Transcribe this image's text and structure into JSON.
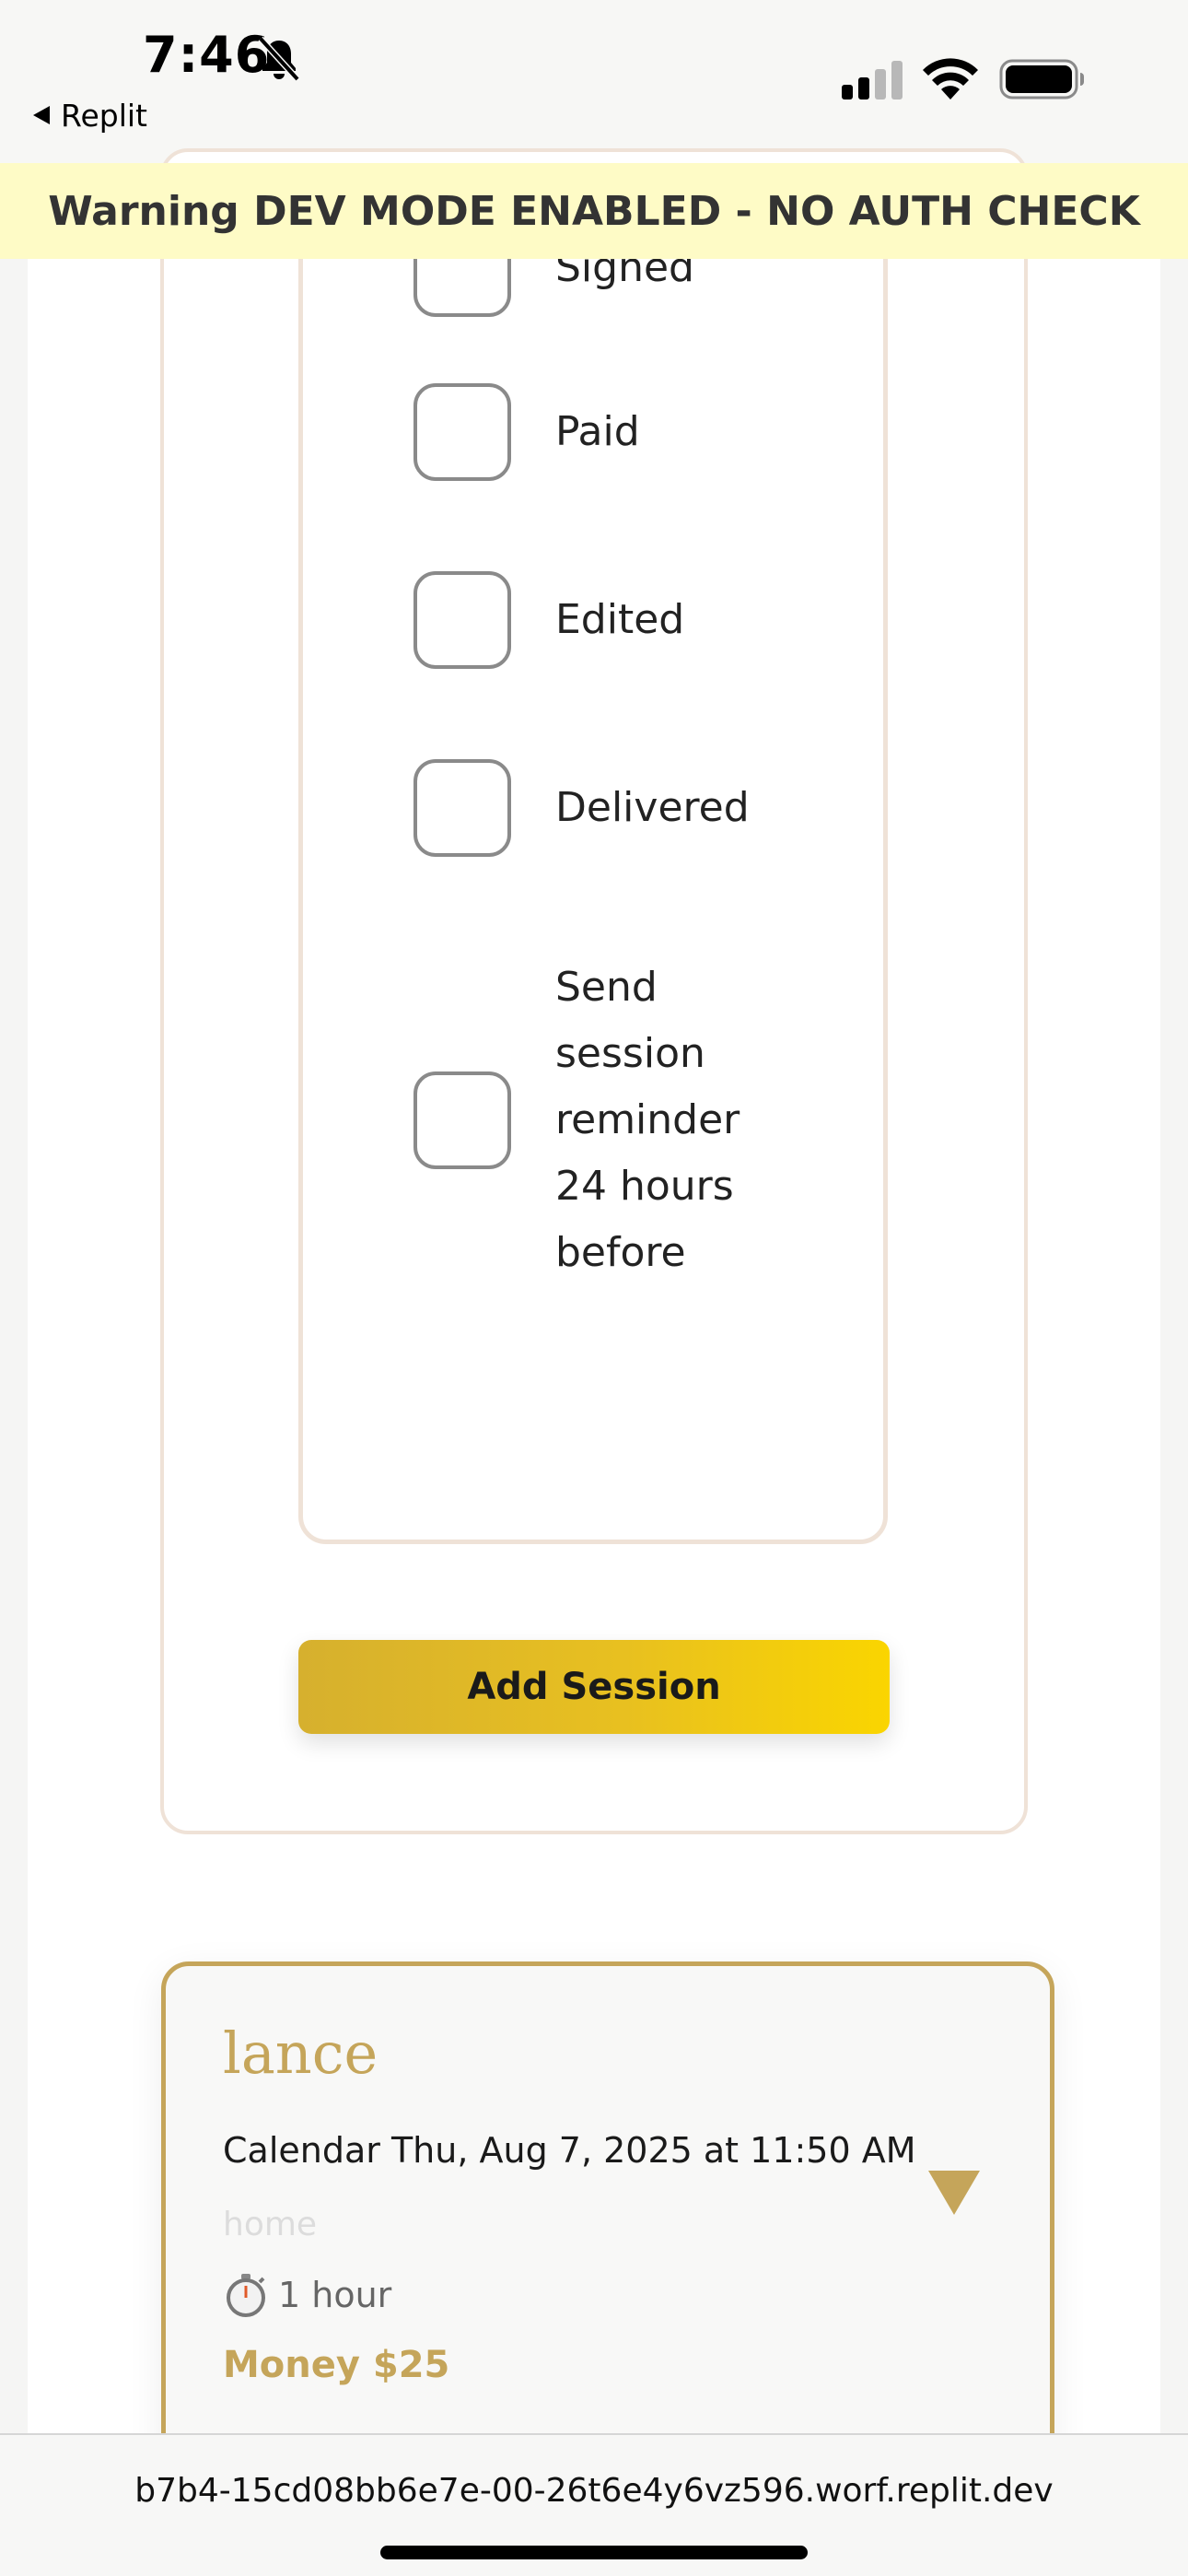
{
  "status_bar": {
    "time": "7:46",
    "back_label": "Replit"
  },
  "banner": {
    "text": "Warning DEV MODE ENABLED - NO AUTH CHECK"
  },
  "form": {
    "checklist": [
      "Signed",
      "Paid",
      "Edited",
      "Delivered",
      "Send session reminder 24 hours before"
    ],
    "add_button_label": "Add Session"
  },
  "session": {
    "client_name": "lance",
    "date_text": "Calendar Thu, Aug 7, 2025 at 11:50 AM",
    "location": "home",
    "duration": "1 hour",
    "price": "Money $25"
  },
  "url_bar": {
    "url": "b7b4-15cd08bb6e7e-00-26t6e4y6vz596.worf.replit.dev"
  },
  "colors": {
    "accent_gold": "#c5a55a",
    "button_gradient_start": "#d6b02e",
    "button_gradient_end": "#fad500",
    "banner_background": "#fefbc6",
    "card_border": "#efe2d7"
  },
  "icons": {
    "bell": "bell-slash-icon",
    "signal": "cellular-signal-icon",
    "wifi": "wifi-icon",
    "battery": "battery-icon",
    "duration": "stopwatch-icon",
    "expand": "triangle-down-icon"
  }
}
